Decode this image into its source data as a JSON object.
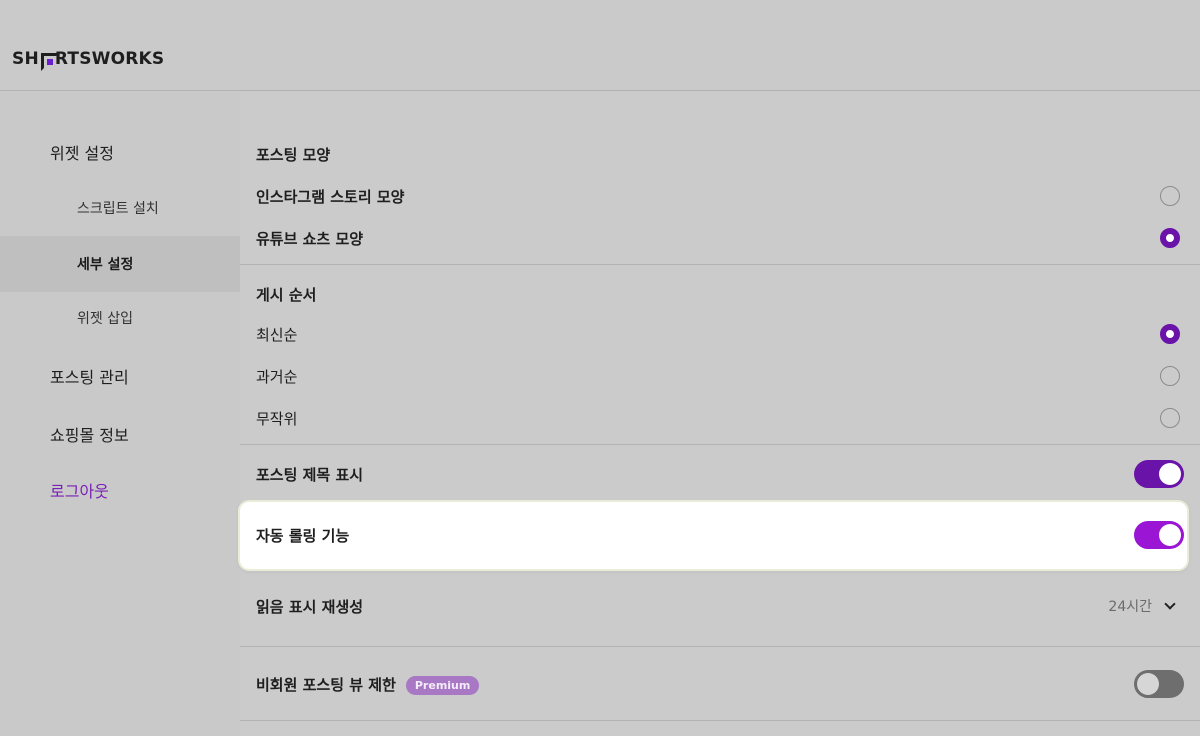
{
  "app": {
    "logo_text_before": "SH",
    "logo_text_after": "RTSWORKS"
  },
  "sidebar": {
    "items": [
      {
        "label": "위젯 설정"
      },
      {
        "label": "스크립트 설치"
      },
      {
        "label": "세부 설정"
      },
      {
        "label": "위젯 삽입"
      },
      {
        "label": "포스팅 관리"
      },
      {
        "label": "쇼핑몰 정보"
      },
      {
        "label": "로그아웃"
      }
    ]
  },
  "posting_shape": {
    "title": "포스팅 모양",
    "options": [
      {
        "label": "인스타그램 스토리 모양",
        "selected": false
      },
      {
        "label": "유튜브 쇼츠 모양",
        "selected": true
      }
    ]
  },
  "post_order": {
    "title": "게시 순서",
    "options": [
      {
        "label": "최신순",
        "selected": true
      },
      {
        "label": "과거순",
        "selected": false
      },
      {
        "label": "무작위",
        "selected": false
      }
    ]
  },
  "settings": {
    "show_title": {
      "label": "포스팅 제목 표시",
      "on": true
    },
    "auto_rolling": {
      "label": "자동 롤링 기능",
      "on": true
    },
    "read_regen": {
      "label": "읽음 표시 재생성",
      "value": "24시간"
    },
    "nonmember_limit": {
      "label": "비회원 포스팅 뷰 제한",
      "badge": "Premium",
      "on": false
    }
  },
  "colors": {
    "accent": "#6a13a8",
    "accent_bright": "#9a16d4",
    "logout": "#7a1fb8",
    "badge": "#a878c4"
  }
}
